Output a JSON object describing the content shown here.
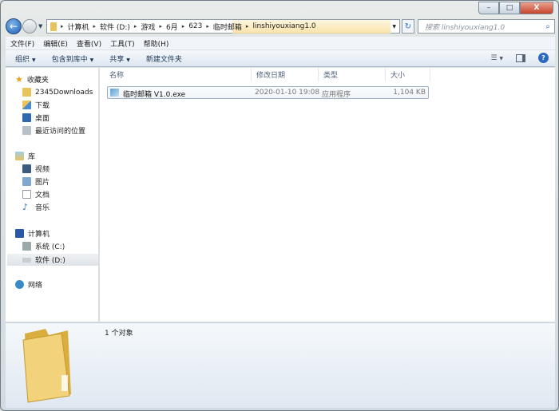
{
  "window": {
    "minimize": "–",
    "maximize": "□",
    "close": "X"
  },
  "address": {
    "crumbs": [
      "计算机",
      "软件 (D:)",
      "游戏",
      "6月",
      "623",
      "临时邮箱",
      "linshiyouxiang1.0"
    ]
  },
  "search": {
    "placeholder": "搜索 linshiyouxiang1.0"
  },
  "menu": [
    "文件(F)",
    "编辑(E)",
    "查看(V)",
    "工具(T)",
    "帮助(H)"
  ],
  "toolbar": {
    "organize": "组织",
    "include": "包含到库中",
    "share": "共享",
    "new_folder": "新建文件夹"
  },
  "nav": {
    "favorites": "收藏夹",
    "fav_items": [
      "2345Downloads",
      "下载",
      "桌面",
      "最近访问的位置"
    ],
    "libraries": "库",
    "lib_items": [
      "视频",
      "图片",
      "文档",
      "音乐"
    ],
    "computer": "计算机",
    "drives": [
      "系统 (C:)",
      "软件 (D:)"
    ],
    "network": "网络"
  },
  "columns": [
    "名称",
    "修改日期",
    "类型",
    "大小"
  ],
  "files": [
    {
      "name": "临时邮箱 V1.0.exe",
      "date": "2020-01-10 19:08",
      "type": "应用程序",
      "size": "1,104 KB"
    }
  ],
  "status": {
    "count": "1 个对象"
  }
}
